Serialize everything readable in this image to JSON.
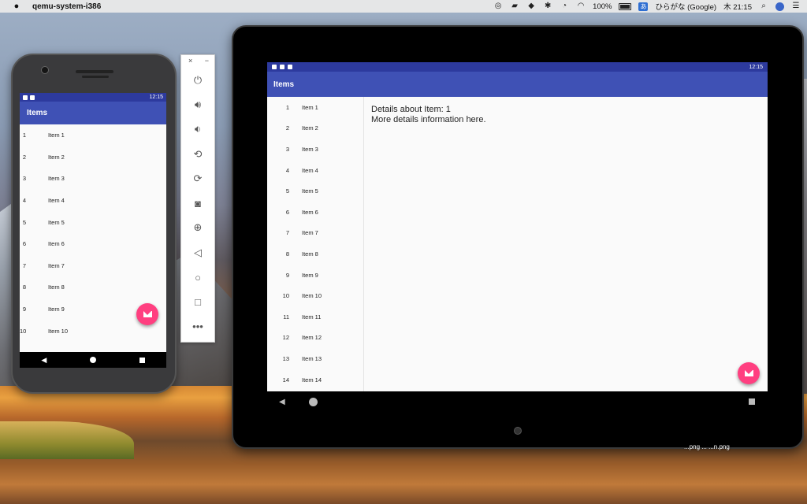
{
  "menubar": {
    "app_name": "qemu-system-i386",
    "battery": "100%",
    "battery_icon_text": "充电",
    "ime_badge": "あ",
    "ime_label": "ひらがな (Google)",
    "clock": "木 21:15"
  },
  "phone": {
    "status_time": "12:15",
    "title": "Items",
    "items": [
      {
        "num": "1",
        "label": "Item 1"
      },
      {
        "num": "2",
        "label": "Item 2"
      },
      {
        "num": "3",
        "label": "Item 3"
      },
      {
        "num": "4",
        "label": "Item 4"
      },
      {
        "num": "5",
        "label": "Item 5"
      },
      {
        "num": "6",
        "label": "Item 6"
      },
      {
        "num": "7",
        "label": "Item 7"
      },
      {
        "num": "8",
        "label": "Item 8"
      },
      {
        "num": "9",
        "label": "Item 9"
      },
      {
        "num": "10",
        "label": "Item 10"
      }
    ]
  },
  "panel": {
    "close": "×",
    "minimize": "−",
    "controls": [
      "power-icon",
      "volume-up-icon",
      "volume-down-icon",
      "rotate-left-icon",
      "rotate-right-icon",
      "camera-icon",
      "zoom-icon",
      "back-icon",
      "home-icon",
      "overview-icon",
      "more-icon"
    ]
  },
  "tablet": {
    "status_time": "12:15",
    "title": "Items",
    "items": [
      {
        "num": "1",
        "label": "Item 1"
      },
      {
        "num": "2",
        "label": "Item 2"
      },
      {
        "num": "3",
        "label": "Item 3"
      },
      {
        "num": "4",
        "label": "Item 4"
      },
      {
        "num": "5",
        "label": "Item 5"
      },
      {
        "num": "6",
        "label": "Item 6"
      },
      {
        "num": "7",
        "label": "Item 7"
      },
      {
        "num": "8",
        "label": "Item 8"
      },
      {
        "num": "9",
        "label": "Item 9"
      },
      {
        "num": "10",
        "label": "Item 10"
      },
      {
        "num": "11",
        "label": "Item 11"
      },
      {
        "num": "12",
        "label": "Item 12"
      },
      {
        "num": "13",
        "label": "Item 13"
      },
      {
        "num": "14",
        "label": "Item 14"
      }
    ],
    "detail_line1": "Details about Item: 1",
    "detail_line2": "More details information here."
  },
  "desktop": {
    "files_label": "...png ... ...n.png"
  },
  "colors": {
    "app_bar": "#3f51b5",
    "status_bar": "#2d3a9e",
    "fab": "#ff3f80"
  }
}
